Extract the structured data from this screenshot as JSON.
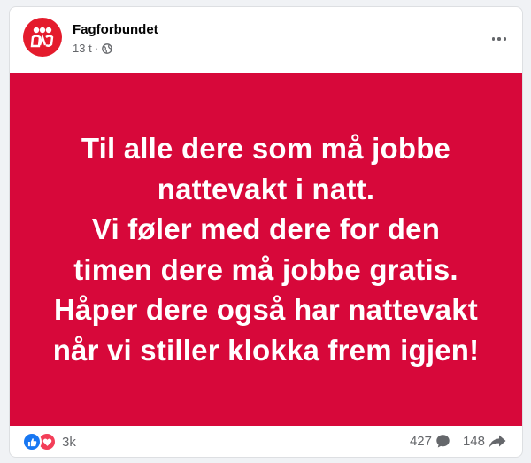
{
  "post": {
    "author": "Fagforbundet",
    "time": "13 t",
    "separator": "·",
    "privacy_icon": "globe-icon",
    "avatar_icon": "fagforbundet-logo-icon",
    "more_icon": "more-options-icon"
  },
  "image": {
    "background": "#d7083a",
    "text_color": "#ffffff",
    "text": "Til alle dere som må jobbe\nnattevakt i natt.\nVi føler med dere for den\ntimen dere må jobbe gratis.\nHåper dere også har nattevakt\nnår vi stiller klokka frem igjen!"
  },
  "engagement": {
    "reaction_icons": [
      "like-icon",
      "love-icon"
    ],
    "reaction_count": "3k",
    "comments_count": "427",
    "comments_icon": "comment-icon",
    "shares_count": "148",
    "shares_icon": "share-icon"
  },
  "colors": {
    "brand_red": "#e41b2c",
    "like_blue": "#1877f2",
    "love_red": "#f33e58",
    "muted_text": "#65676b"
  }
}
